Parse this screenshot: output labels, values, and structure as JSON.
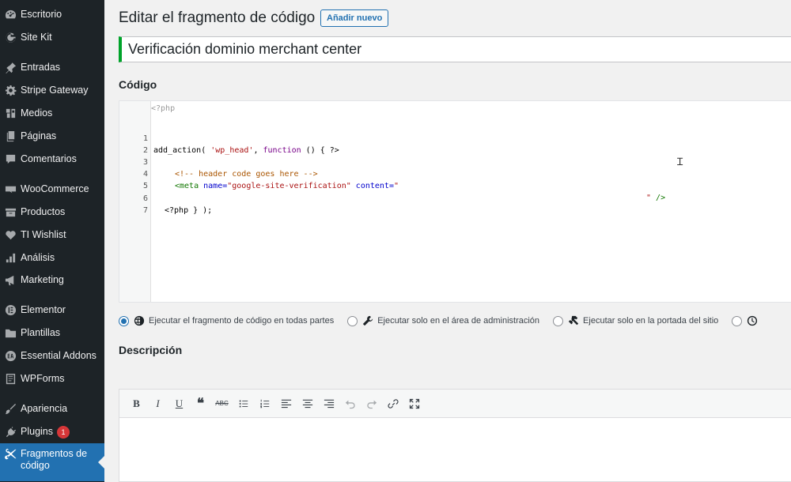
{
  "sidebar": {
    "items": [
      {
        "label": "Escritorio",
        "icon": "dashboard-icon"
      },
      {
        "label": "Site Kit",
        "icon": "google-g-icon"
      },
      {
        "label": "Entradas",
        "icon": "pin-icon"
      },
      {
        "label": "Stripe Gateway",
        "icon": "gear-icon"
      },
      {
        "label": "Medios",
        "icon": "media-icon"
      },
      {
        "label": "Páginas",
        "icon": "pages-icon"
      },
      {
        "label": "Comentarios",
        "icon": "comment-icon"
      },
      {
        "label": "WooCommerce",
        "icon": "woocommerce-icon"
      },
      {
        "label": "Productos",
        "icon": "products-icon"
      },
      {
        "label": "TI Wishlist",
        "icon": "heart-icon"
      },
      {
        "label": "Análisis",
        "icon": "bar-chart-icon"
      },
      {
        "label": "Marketing",
        "icon": "megaphone-icon"
      },
      {
        "label": "Elementor",
        "icon": "elementor-icon"
      },
      {
        "label": "Plantillas",
        "icon": "folder-icon"
      },
      {
        "label": "Essential Addons",
        "icon": "ea-icon"
      },
      {
        "label": "WPForms",
        "icon": "forms-icon"
      },
      {
        "label": "Apariencia",
        "icon": "brush-icon"
      },
      {
        "label": "Plugins",
        "icon": "plug-icon",
        "badge": "1"
      },
      {
        "label": "Fragmentos de código",
        "icon": "scissors-icon",
        "active": true
      }
    ],
    "active_color": "#2271b1",
    "bg_color": "#1d2327",
    "badge_color": "#d63638"
  },
  "header": {
    "title": "Editar el fragmento de código",
    "add_new_label": "Añadir nuevo"
  },
  "snippet": {
    "title_value": "Verificación dominio merchant center",
    "accent_color": "#00a32a"
  },
  "code": {
    "section_label": "Código",
    "php_open_tag": "<?php",
    "lines": [
      {
        "n": "1"
      },
      {
        "n": "2"
      },
      {
        "n": "3"
      },
      {
        "n": "4"
      },
      {
        "n": "5"
      },
      {
        "n": "6"
      },
      {
        "n": "7"
      }
    ],
    "l1_fn": "add_action( ",
    "l1_str": "'wp_head'",
    "l1_sep": ", ",
    "l1_kw": "function",
    "l1_rest": " () { ?>",
    "l3_comment": "<!-- header code goes here -->",
    "l4_tag_open": "<meta",
    "l4_attr1": " name=",
    "l4_val1": "\"google-site-verification\"",
    "l4_attr2": " content=",
    "l4_val2": "\"",
    "l4_val2_end": "\"",
    "l4_close": " />",
    "l6": "<?php } );"
  },
  "scope": {
    "options": [
      {
        "label": "Ejecutar el fragmento de código en todas partes",
        "icon": "globe-icon",
        "checked": true
      },
      {
        "label": "Ejecutar solo en el área de administración",
        "icon": "wrench-icon",
        "checked": false
      },
      {
        "label": "Ejecutar solo en la portada del sitio",
        "icon": "hammer-icon",
        "checked": false
      },
      {
        "label": "",
        "icon": "clock-icon",
        "checked": false
      }
    ]
  },
  "description": {
    "section_label": "Descripción",
    "toolbar": [
      "bold-icon",
      "italic-icon",
      "underline-icon",
      "blockquote-icon",
      "strikethrough-icon",
      "bullet-list-icon",
      "numbered-list-icon",
      "align-left-icon",
      "align-center-icon",
      "align-right-icon",
      "undo-icon",
      "redo-icon",
      "link-icon",
      "fullscreen-icon"
    ]
  }
}
